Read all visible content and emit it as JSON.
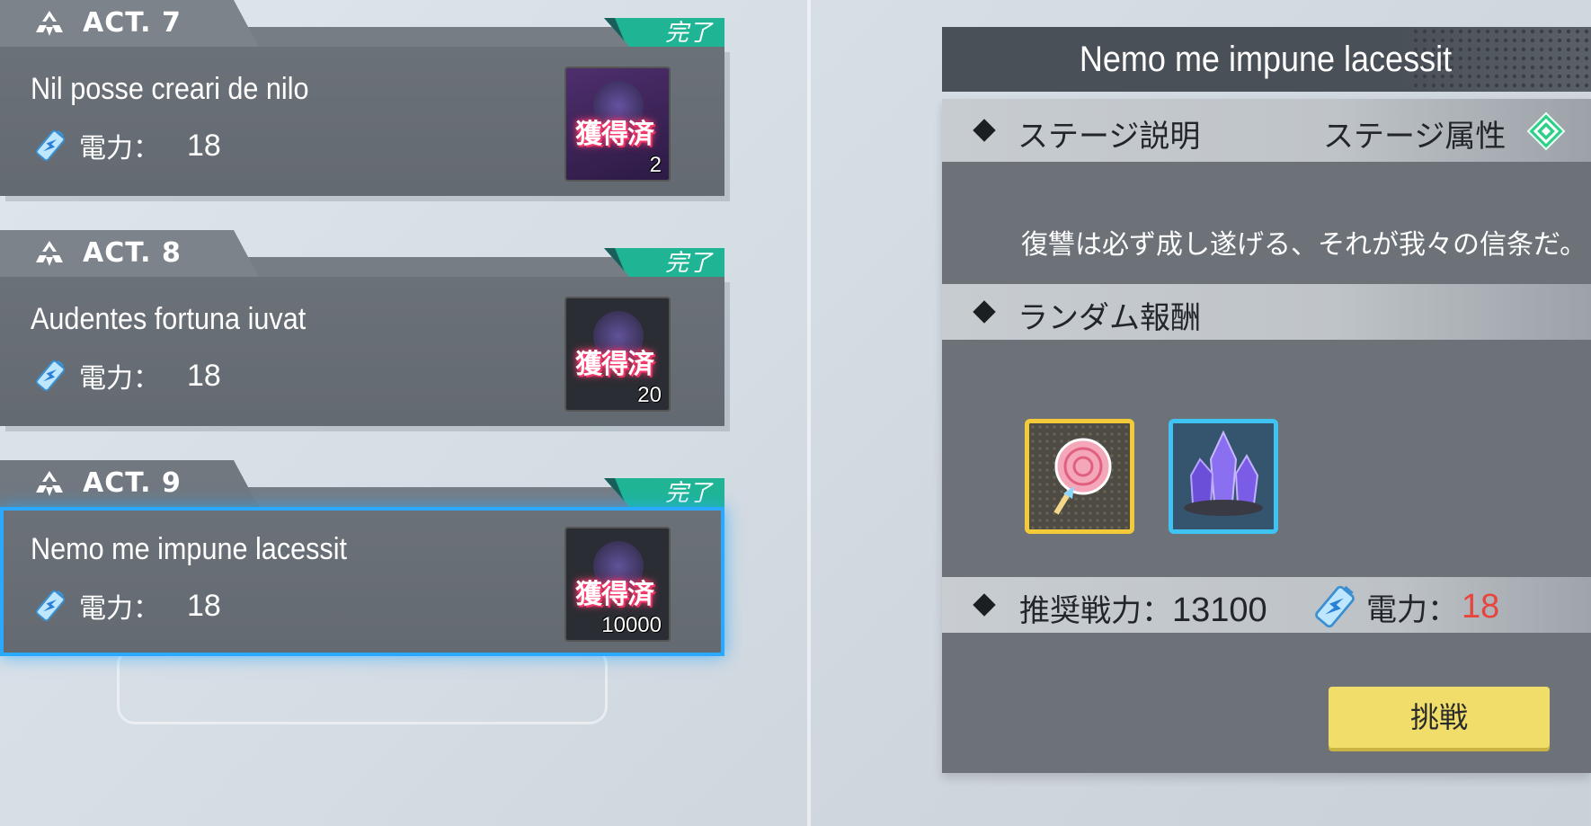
{
  "acts": [
    {
      "act_label": "ACT. 7",
      "done": "完了",
      "title": "Nil posse creari de nilo",
      "energy_label": "電力：",
      "energy_value": "18",
      "reward_stamp": "獲得済",
      "reward_qty": "2",
      "reward_icon": "bottle-icon"
    },
    {
      "act_label": "ACT. 8",
      "done": "完了",
      "title": "Audentes fortuna iuvat",
      "energy_label": "電力：",
      "energy_value": "18",
      "reward_stamp": "獲得済",
      "reward_qty": "20",
      "reward_icon": "orb-icon"
    },
    {
      "act_label": "ACT. 9",
      "done": "完了",
      "title": "Nemo me impune lacessit",
      "energy_label": "電力：",
      "energy_value": "18",
      "reward_stamp": "獲得済",
      "reward_qty": "10000",
      "reward_icon": "crystal-icon",
      "selected": true
    }
  ],
  "panel": {
    "title": "Nemo me impune lacessit",
    "stage_desc_label": "ステージ説明",
    "stage_attr_label": "ステージ属性",
    "description": "復讐は必ず成し遂げる、それが我々の信条だ。",
    "random_reward_label": "ランダム報酬",
    "rewards": [
      {
        "name": "candy-icon",
        "frame": "gold"
      },
      {
        "name": "purple-crystal-icon",
        "frame": "blue"
      }
    ],
    "recommended_power_label": "推奨戦力：",
    "recommended_power_value": "13100",
    "energy_label": "電力：",
    "energy_value": "18",
    "challenge_label": "挑戦"
  },
  "colors": {
    "accent_blue": "#2aa9ff",
    "done_green": "#1fb594",
    "energy_red": "#e8453c",
    "button_yellow": "#f1dd6a"
  }
}
